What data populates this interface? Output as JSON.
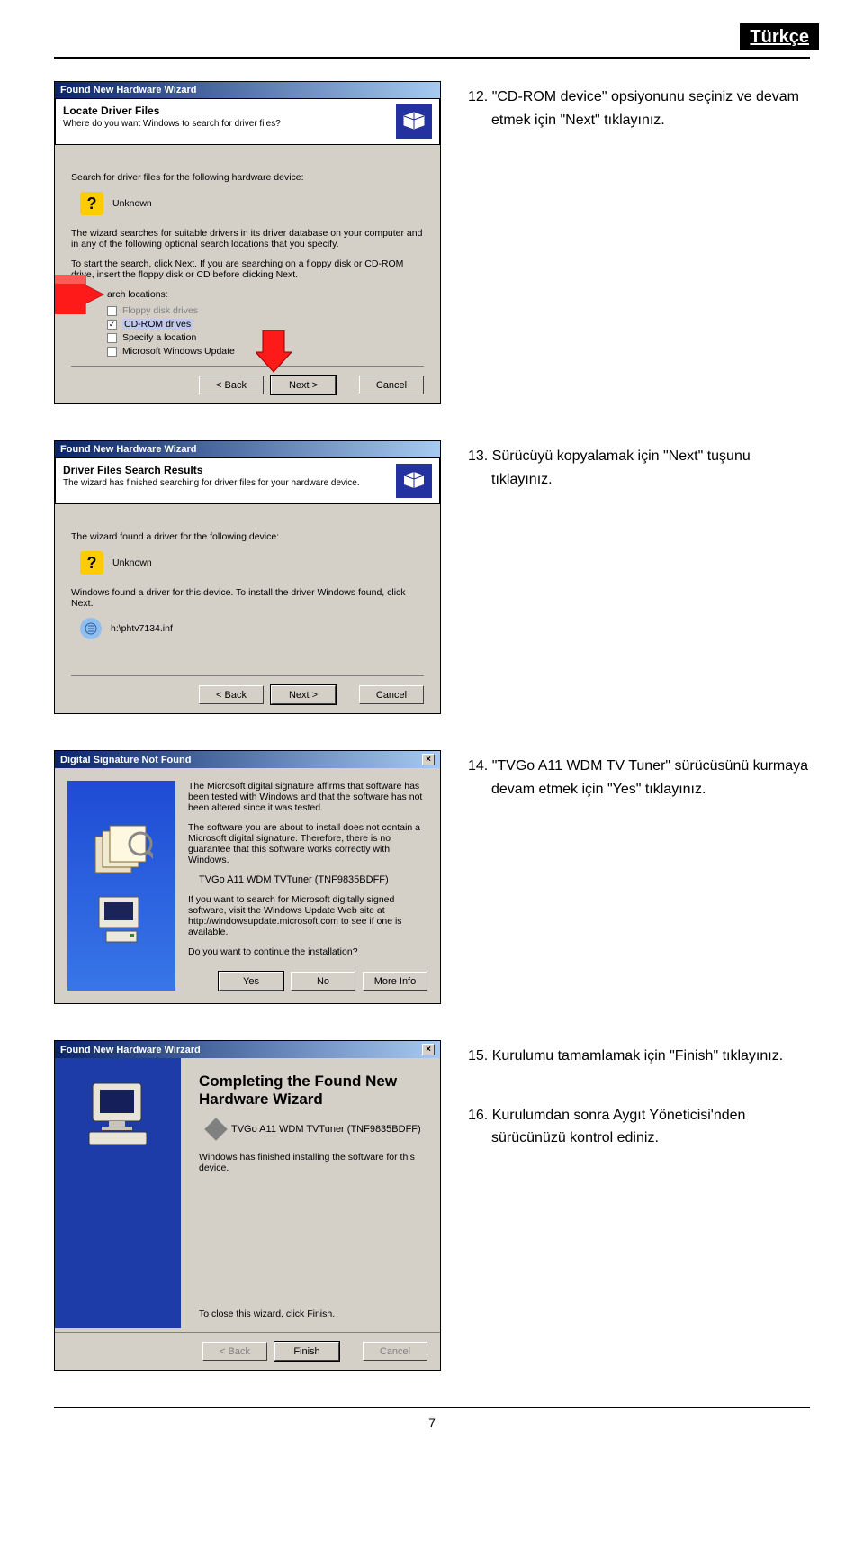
{
  "page": {
    "lang_badge": "Türkçe",
    "page_number": "7"
  },
  "steps": {
    "s12": "12. \"CD-ROM device\" opsiyonunu seçiniz ve devam etmek için \"Next\" tıklayınız.",
    "s13": "13. Sürücüyü kopyalamak için \"Next\" tuşunu tıklayınız.",
    "s14": "14.  \"TVGo A11 WDM TV Tuner\" sürücüsünü kurmaya devam etmek için \"Yes\" tıklayınız.",
    "s15": "15. Kurulumu tamamlamak için \"Finish\" tıklayınız.",
    "s16": "16. Kurulumdan sonra Aygıt Yöneticisi'nden sürücünüzü kontrol ediniz."
  },
  "dlg1": {
    "title": "Found New Hardware Wizard",
    "head_title": "Locate Driver Files",
    "head_sub": "Where do you want Windows to search for driver files?",
    "line1": "Search for driver files for the following hardware device:",
    "device": "Unknown",
    "para1": "The wizard searches for suitable drivers in its driver database on your computer and in any of the following optional search locations that you specify.",
    "para2": "To start the search, click Next. If you are searching on a floppy disk or CD-ROM drive, insert the floppy disk or CD before clicking Next.",
    "locations_label": "arch locations:",
    "opt_floppy": "Floppy disk drives",
    "opt_cdrom": "CD-ROM drives",
    "opt_specify": "Specify a location",
    "opt_wu": "Microsoft Windows Update",
    "btn_back": "< Back",
    "btn_next": "Next >",
    "btn_cancel": "Cancel"
  },
  "dlg2": {
    "title": "Found New Hardware Wizard",
    "head_title": "Driver Files Search Results",
    "head_sub": "The wizard has finished searching for driver files for your hardware device.",
    "line1": "The wizard found a driver for the following device:",
    "device": "Unknown",
    "line2": "Windows found a driver for this device. To install the driver Windows found, click Next.",
    "inf_path": "h:\\phtv7134.inf",
    "btn_back": "< Back",
    "btn_next": "Next >",
    "btn_cancel": "Cancel"
  },
  "dlg3": {
    "title": "Digital Signature Not Found",
    "para1": "The Microsoft digital signature affirms that software has been tested with Windows and that the software has not been altered since it was tested.",
    "para2": "The software you are about to install does not contain a Microsoft digital signature. Therefore, there is no guarantee that this software works correctly with Windows.",
    "product": "TVGo A11 WDM TVTuner (TNF9835BDFF)",
    "para3": "If you want to search for Microsoft digitally signed software, visit the Windows Update Web site at http://windowsupdate.microsoft.com to see if one is available.",
    "para4": "Do you want to continue the installation?",
    "btn_yes": "Yes",
    "btn_no": "No",
    "btn_more": "More Info"
  },
  "dlg4": {
    "title": "Found New Hardware Wirzard",
    "complete_title": "Completing the Found New Hardware Wizard",
    "device": "TVGo A11 WDM TVTuner (TNF9835BDFF)",
    "line1": "Windows has finished installing the software for this device.",
    "close_hint": "To close this wizard, click Finish.",
    "btn_back": "< Back",
    "btn_finish": "Finish",
    "btn_cancel": "Cancel"
  }
}
